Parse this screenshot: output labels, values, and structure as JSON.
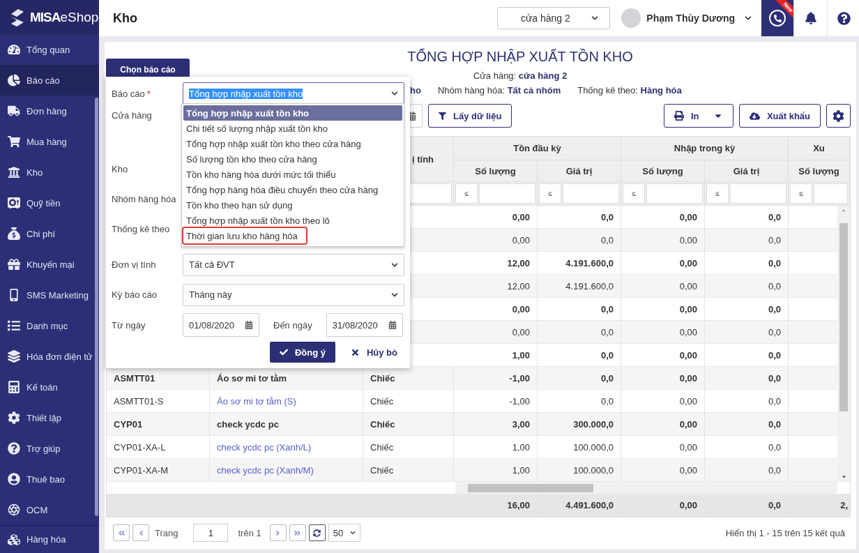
{
  "sidebar": {
    "logo": {
      "brand": "MISA",
      "product": "eShop"
    },
    "items": [
      {
        "label": "Tổng quan",
        "selected": false
      },
      {
        "label": "Báo cáo",
        "selected": true
      },
      {
        "label": "Đơn hàng",
        "selected": false
      },
      {
        "label": "Mua hàng",
        "selected": false
      },
      {
        "label": "Kho",
        "selected": false
      },
      {
        "label": "Quỹ tiền",
        "selected": false
      },
      {
        "label": "Chi phí",
        "selected": false
      },
      {
        "label": "Khuyến mại",
        "selected": false
      },
      {
        "label": "SMS Marketing",
        "selected": false
      },
      {
        "label": "Danh mục",
        "selected": false
      },
      {
        "label": "Hóa đơn điện tử",
        "selected": false
      },
      {
        "label": "Kế toán",
        "selected": false
      },
      {
        "label": "Thiết lập",
        "selected": false
      },
      {
        "label": "Trợ giúp",
        "selected": false
      },
      {
        "label": "Thuê bao",
        "selected": false
      },
      {
        "label": "OCM",
        "selected": false
      }
    ],
    "footer_item": {
      "label": "Hàng hóa"
    }
  },
  "header": {
    "title": "Kho",
    "store_select": "cửa hàng 2",
    "user": "Phạm Thùy Dương",
    "badge": "New"
  },
  "report": {
    "title": "TỔNG HỢP NHẬP XUẤT TỒN KHO",
    "store": {
      "label": "Cửa hàng:",
      "value": "cửa hàng 2"
    },
    "filters": [
      {
        "value": "ho"
      },
      {
        "label": "Nhóm hàng hóa:",
        "value": "Tất cả nhóm"
      },
      {
        "label": "Thống kê theo:",
        "value": "Hàng hóa"
      }
    ]
  },
  "toolbar": {
    "fetch_button": "Lấy dữ liệu",
    "print_button": "In",
    "export_button": "Xuất khẩu"
  },
  "table": {
    "unit_header": "ị tính",
    "groups": [
      "Tồn đầu kỳ",
      "Nhập trong kỳ",
      "Xu"
    ],
    "sub_headers": [
      "Số lượng",
      "Giá trị",
      "Số lượng",
      "Giá trị",
      "Số lượng"
    ],
    "filter_ops": [
      "≤",
      "≤",
      "≤",
      "≤",
      "≤"
    ],
    "rows": [
      {
        "kind": "group",
        "values": [
          "0,00",
          "0,0",
          "0,00",
          "0,0"
        ]
      },
      {
        "kind": "item",
        "values": [
          "0,00",
          "0,0",
          "0,00",
          "0,0"
        ]
      },
      {
        "kind": "group",
        "values": [
          "12,00",
          "4.191.600,0",
          "0,00",
          "0,0"
        ]
      },
      {
        "kind": "item",
        "values": [
          "12,00",
          "4.191.600,0",
          "0,00",
          "0,0"
        ]
      },
      {
        "kind": "group",
        "values": [
          "0,00",
          "0,0",
          "0,00",
          "0,0"
        ]
      },
      {
        "kind": "item",
        "values": [
          "0,00",
          "0,0",
          "0,00",
          "0,0"
        ]
      },
      {
        "kind": "group",
        "values": [
          "1,00",
          "0,0",
          "0,00",
          "0,0"
        ]
      },
      {
        "kind": "group",
        "code": "ASMTT01",
        "name": "Áo sơ mi tơ tằm",
        "unit": "Chiếc",
        "values": [
          "-1,00",
          "0,0",
          "0,00",
          "0,0"
        ]
      },
      {
        "kind": "item",
        "code": "ASMTT01-S",
        "name": "Áo sơ mi tơ tằm (S)",
        "unit": "Chiếc",
        "values": [
          "-1,00",
          "0,0",
          "0,00",
          "0,0"
        ]
      },
      {
        "kind": "group",
        "code": "CYP01",
        "name": "check ycdc pc",
        "unit": "Chiếc",
        "values": [
          "3,00",
          "300.000,0",
          "0,00",
          "0,0"
        ]
      },
      {
        "kind": "item",
        "code": "CYP01-XA-L",
        "name": "check ycdc pc (Xanh/L)",
        "unit": "Chiếc",
        "values": [
          "1,00",
          "100.000,0",
          "0,00",
          "0,0"
        ]
      },
      {
        "kind": "item",
        "code": "CYP01-XA-M",
        "name": "check ycdc pc (Xanh/M)",
        "unit": "Chiếc",
        "values": [
          "1,00",
          "100.000,0",
          "0,00",
          "0,0"
        ]
      }
    ],
    "totals": [
      "16,00",
      "4.491.600,0",
      "0,00",
      "0,0",
      "2,"
    ]
  },
  "pagination": {
    "page_label": "Trang",
    "page": "1",
    "of": "trên 1",
    "page_size": "50",
    "summary": "Hiển thị 1 - 15 trên 15 kết quả"
  },
  "dialog": {
    "tab": "Chọn báo cáo",
    "fields": [
      {
        "kind": "report",
        "label": "Báo cáo",
        "required_mark": "*",
        "value": "Tổng hợp nhập xuất tồn kho"
      },
      {
        "kind": "covered_multi",
        "label": "Cửa hàng"
      },
      {
        "kind": "covered",
        "label": "Kho"
      },
      {
        "kind": "covered",
        "label": "Nhóm hàng hóa"
      },
      {
        "kind": "covered",
        "label": "Thống kê theo"
      },
      {
        "kind": "select",
        "label": "Đơn vị tính",
        "value": "Tất cả ĐVT"
      },
      {
        "kind": "select",
        "label": "Kỳ báo cáo",
        "value": "Tháng này"
      },
      {
        "kind": "range",
        "label": "Từ ngày",
        "value": "01/08/2020",
        "end_label": "Đến ngày",
        "end_value": "31/08/2020"
      }
    ],
    "options": [
      {
        "label": "Tổng hợp nhập xuất tồn kho",
        "selected": true,
        "marked": false
      },
      {
        "label": "Chi tiết số lượng nhập xuất tồn kho",
        "selected": false,
        "marked": false
      },
      {
        "label": "Tổng hợp nhập xuất tồn kho theo cửa hàng",
        "selected": false,
        "marked": false
      },
      {
        "label": "Số lượng tồn kho theo cửa hàng",
        "selected": false,
        "marked": false
      },
      {
        "label": "Tồn kho hàng hóa dưới mức tối thiểu",
        "selected": false,
        "marked": false
      },
      {
        "label": "Tổng hợp hàng hóa điều chuyển theo cửa hàng",
        "selected": false,
        "marked": false
      },
      {
        "label": "Tồn kho theo hạn sử dụng",
        "selected": false,
        "marked": false
      },
      {
        "label": "Tổng hợp nhập xuất tồn kho theo lô",
        "selected": false,
        "marked": false
      },
      {
        "label": "Thời gian lưu kho hàng hóa",
        "selected": false,
        "marked": true
      }
    ],
    "confirm": "Đồng ý",
    "cancel": "Hủy bỏ"
  }
}
